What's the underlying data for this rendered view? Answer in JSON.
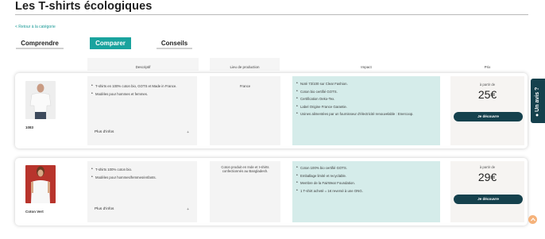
{
  "header": {
    "title": "Les T-shirts écologiques",
    "back_link": "< Retour à la catégorie"
  },
  "tabs": [
    {
      "label": "Comprendre",
      "active": false
    },
    {
      "label": "Comparer",
      "active": true
    },
    {
      "label": "Conseils",
      "active": false
    }
  ],
  "columns": {
    "descriptif": "Descriptif",
    "lieu": "Lieu de production",
    "impact": "Impact",
    "prix": "Prix"
  },
  "products": [
    {
      "name": "1083",
      "descriptif": [
        "T-shirts en 100% coton bio, GOTS et Made in France.",
        "Modèles pour hommes et femmes."
      ],
      "plus_infos": "Plus d'infos",
      "plus_sign": "+",
      "lieu": "France",
      "impact": [
        "Noté 73/100 sur Clear Fashion.",
        "Coton bio certifié GOTS.",
        "Certification Oeko-Tex.",
        "Label Origine France Garantie.",
        "Usines alimentées par un fournisseur d'électricité renouvelable : Enercoop."
      ],
      "prix_label": "à partir de",
      "prix": "25€",
      "cta": "Je découvre"
    },
    {
      "name": "Coton Vert",
      "descriptif": [
        "T-shirts 100% coton bio.",
        "Modèles pour hommes/femmes/enfants."
      ],
      "plus_infos": "Plus d'infos",
      "plus_sign": "+",
      "lieu": "Coton produit en Inde et t-shirts confectionnés au Bangladesh.",
      "impact": [
        "Coton 100% bio certifié GOTS.",
        "Emballage limité et recyclable.",
        "Membre de la FairWear Foundation.",
        "1 T-shirt acheté = 1€ reversé à une ONG."
      ],
      "prix_label": "à partir de",
      "prix": "29€",
      "cta": "Je découvre"
    }
  ],
  "feedback_tab": {
    "label": "Un avis ?"
  },
  "colors": {
    "accent": "#1aa39e",
    "dark_button": "#15414d",
    "impact_bg": "#d5ecea",
    "scroll_button": "#f5b27a"
  }
}
